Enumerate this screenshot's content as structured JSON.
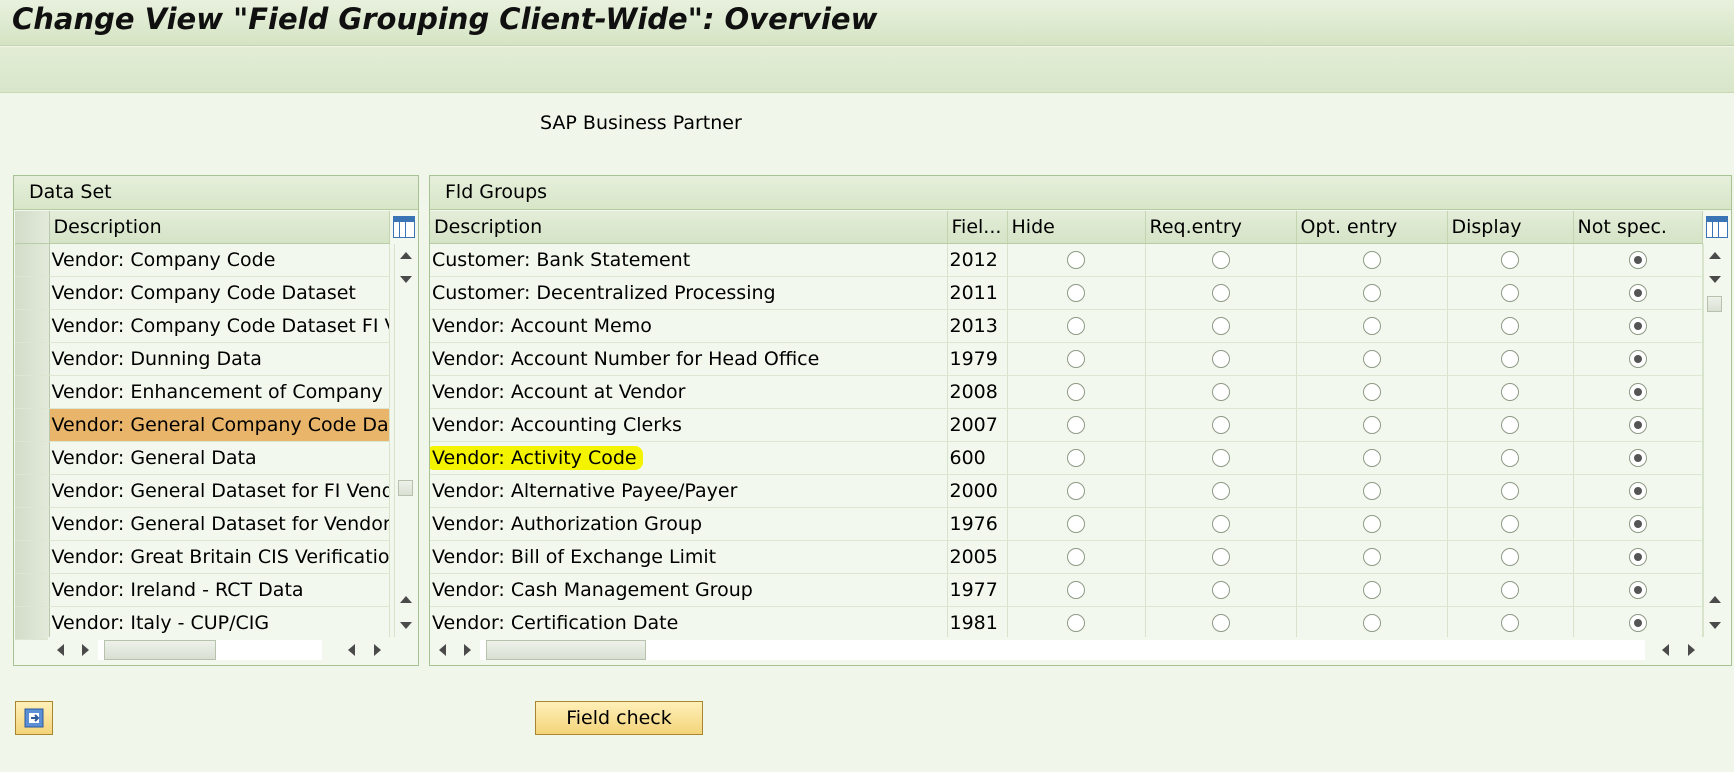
{
  "window": {
    "title": "Change View \"Field Grouping Client-Wide\": Overview"
  },
  "context_label": "SAP Business Partner",
  "data_set": {
    "title": "Data Set",
    "column_header": "Description",
    "rows": [
      "Vendor: Company Code",
      "Vendor: Company Code Dataset",
      "Vendor: Company Code Dataset FI Ven",
      "Vendor: Dunning Data",
      "Vendor: Enhancement of Company Coc",
      "Vendor: General Company Code Data",
      "Vendor: General Data",
      "Vendor: General Dataset for FI Vendor",
      "Vendor: General Dataset for Vendor",
      "Vendor: Great Britain CIS Verification",
      "Vendor: Ireland - RCT Data",
      "Vendor: Italy - CUP/CIG"
    ],
    "selected_index": 5
  },
  "fld_groups": {
    "title": "Fld Groups",
    "columns": [
      "Description",
      "Fiel...",
      "Hide",
      "Req.entry",
      "Opt. entry",
      "Display",
      "Not spec."
    ],
    "rows": [
      {
        "description": "Customer: Bank Statement",
        "field": "2012",
        "selected": "Not spec."
      },
      {
        "description": "Customer: Decentralized Processing",
        "field": "2011",
        "selected": "Not spec."
      },
      {
        "description": "Vendor: Account Memo",
        "field": "2013",
        "selected": "Not spec."
      },
      {
        "description": "Vendor: Account Number for Head Office",
        "field": "1979",
        "selected": "Not spec."
      },
      {
        "description": "Vendor: Account at Vendor",
        "field": "2008",
        "selected": "Not spec."
      },
      {
        "description": "Vendor: Accounting Clerks",
        "field": "2007",
        "selected": "Not spec."
      },
      {
        "description": "Vendor: Activity Code",
        "field": "600",
        "selected": "Not spec.",
        "highlighted": true
      },
      {
        "description": "Vendor: Alternative Payee/Payer",
        "field": "2000",
        "selected": "Not spec."
      },
      {
        "description": "Vendor: Authorization Group",
        "field": "1976",
        "selected": "Not spec."
      },
      {
        "description": "Vendor: Bill of Exchange Limit",
        "field": "2005",
        "selected": "Not spec."
      },
      {
        "description": "Vendor: Cash Management Group",
        "field": "1977",
        "selected": "Not spec."
      },
      {
        "description": "Vendor: Certification Date",
        "field": "1981",
        "selected": "Not spec."
      }
    ]
  },
  "buttons": {
    "field_check": "Field check"
  },
  "icons": {
    "toggle_button": "export-icon",
    "column_settings": "column-settings-icon"
  },
  "colors": {
    "selected_row": "#e8b56a",
    "highlight": "#f4f400",
    "panel_bg": "#f3f8ee"
  }
}
